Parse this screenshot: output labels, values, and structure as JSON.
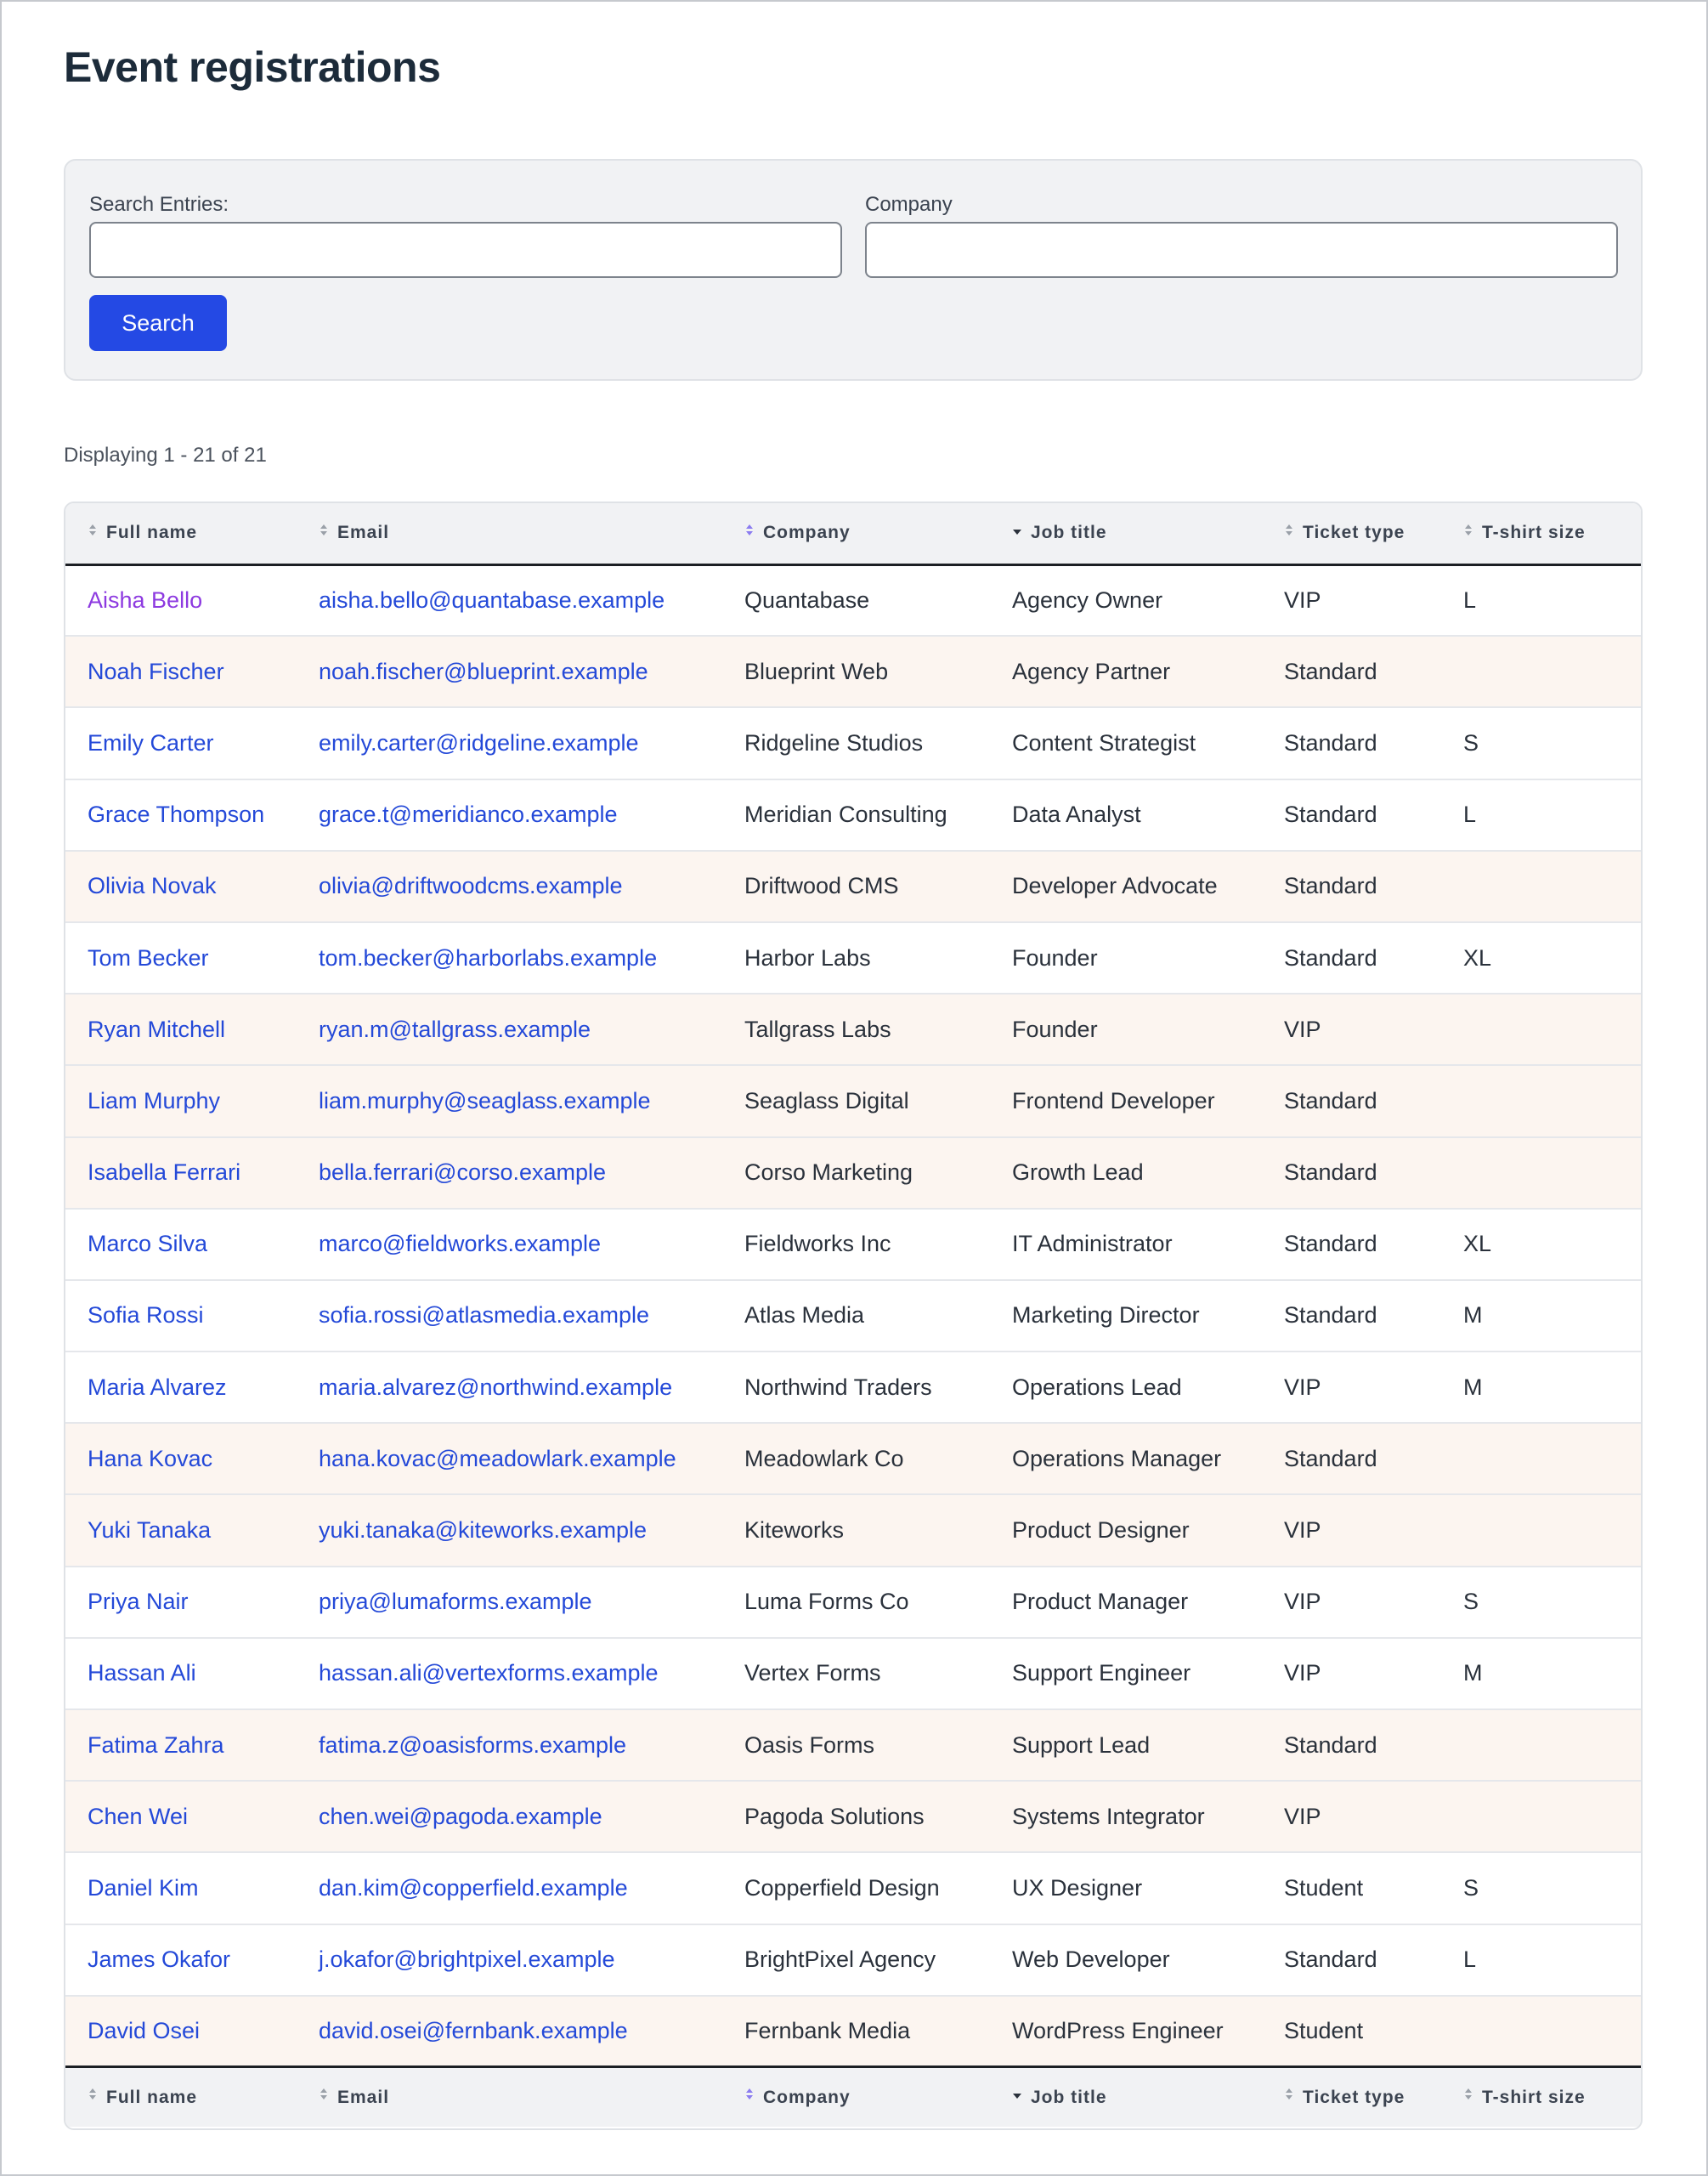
{
  "page": {
    "title": "Event registrations"
  },
  "search": {
    "entries_label": "Search Entries:",
    "entries_value": "",
    "company_label": "Company",
    "company_value": "",
    "button_label": "Search"
  },
  "result_count": "Displaying 1 - 21 of 21",
  "columns": [
    "Full name",
    "Email",
    "Company",
    "Job title",
    "Ticket type",
    "T-shirt size"
  ],
  "colors": {
    "link": "#2449d8",
    "visited_link": "#8d3ae0",
    "button": "#2449e4",
    "alt_row": "#fcf5f0",
    "header_bg": "#f1f2f4",
    "active_sort": "#8b7cf0"
  },
  "sort": {
    "active_column": "Job title",
    "direction": "descending"
  },
  "rows": [
    {
      "name": "Aisha Bello",
      "email": "aisha.bello@quantabase.example",
      "company": "Quantabase",
      "job": "Agency Owner",
      "ticket": "VIP",
      "size": "L",
      "highlight": false,
      "visited": true
    },
    {
      "name": "Noah Fischer",
      "email": "noah.fischer@blueprint.example",
      "company": "Blueprint Web",
      "job": "Agency Partner",
      "ticket": "Standard",
      "size": "",
      "highlight": true
    },
    {
      "name": "Emily Carter",
      "email": "emily.carter@ridgeline.example",
      "company": "Ridgeline Studios",
      "job": "Content Strategist",
      "ticket": "Standard",
      "size": "S",
      "highlight": false
    },
    {
      "name": "Grace Thompson",
      "email": "grace.t@meridianco.example",
      "company": "Meridian Consulting",
      "job": "Data Analyst",
      "ticket": "Standard",
      "size": "L",
      "highlight": false
    },
    {
      "name": "Olivia Novak",
      "email": "olivia@driftwoodcms.example",
      "company": "Driftwood CMS",
      "job": "Developer Advocate",
      "ticket": "Standard",
      "size": "",
      "highlight": true
    },
    {
      "name": "Tom Becker",
      "email": "tom.becker@harborlabs.example",
      "company": "Harbor Labs",
      "job": "Founder",
      "ticket": "Standard",
      "size": "XL",
      "highlight": false
    },
    {
      "name": "Ryan Mitchell",
      "email": "ryan.m@tallgrass.example",
      "company": "Tallgrass Labs",
      "job": "Founder",
      "ticket": "VIP",
      "size": "",
      "highlight": true
    },
    {
      "name": "Liam Murphy",
      "email": "liam.murphy@seaglass.example",
      "company": "Seaglass Digital",
      "job": "Frontend Developer",
      "ticket": "Standard",
      "size": "",
      "highlight": true
    },
    {
      "name": "Isabella Ferrari",
      "email": "bella.ferrari@corso.example",
      "company": "Corso Marketing",
      "job": "Growth Lead",
      "ticket": "Standard",
      "size": "",
      "highlight": true
    },
    {
      "name": "Marco Silva",
      "email": "marco@fieldworks.example",
      "company": "Fieldworks Inc",
      "job": "IT Administrator",
      "ticket": "Standard",
      "size": "XL",
      "highlight": false
    },
    {
      "name": "Sofia Rossi",
      "email": "sofia.rossi@atlasmedia.example",
      "company": "Atlas Media",
      "job": "Marketing Director",
      "ticket": "Standard",
      "size": "M",
      "highlight": false
    },
    {
      "name": "Maria Alvarez",
      "email": "maria.alvarez@northwind.example",
      "company": "Northwind Traders",
      "job": "Operations Lead",
      "ticket": "VIP",
      "size": "M",
      "highlight": false
    },
    {
      "name": "Hana Kovac",
      "email": "hana.kovac@meadowlark.example",
      "company": "Meadowlark Co",
      "job": "Operations Manager",
      "ticket": "Standard",
      "size": "",
      "highlight": true
    },
    {
      "name": "Yuki Tanaka",
      "email": "yuki.tanaka@kiteworks.example",
      "company": "Kiteworks",
      "job": "Product Designer",
      "ticket": "VIP",
      "size": "",
      "highlight": true
    },
    {
      "name": "Priya Nair",
      "email": "priya@lumaforms.example",
      "company": "Luma Forms Co",
      "job": "Product Manager",
      "ticket": "VIP",
      "size": "S",
      "highlight": false
    },
    {
      "name": "Hassan Ali",
      "email": "hassan.ali@vertexforms.example",
      "company": "Vertex Forms",
      "job": "Support Engineer",
      "ticket": "VIP",
      "size": "M",
      "highlight": false
    },
    {
      "name": "Fatima Zahra",
      "email": "fatima.z@oasisforms.example",
      "company": "Oasis Forms",
      "job": "Support Lead",
      "ticket": "Standard",
      "size": "",
      "highlight": true
    },
    {
      "name": "Chen Wei",
      "email": "chen.wei@pagoda.example",
      "company": "Pagoda Solutions",
      "job": "Systems Integrator",
      "ticket": "VIP",
      "size": "",
      "highlight": true
    },
    {
      "name": "Daniel Kim",
      "email": "dan.kim@copperfield.example",
      "company": "Copperfield Design",
      "job": "UX Designer",
      "ticket": "Student",
      "size": "S",
      "highlight": false
    },
    {
      "name": "James Okafor",
      "email": "j.okafor@brightpixel.example",
      "company": "BrightPixel Agency",
      "job": "Web Developer",
      "ticket": "Standard",
      "size": "L",
      "highlight": false
    },
    {
      "name": "David Osei",
      "email": "david.osei@fernbank.example",
      "company": "Fernbank Media",
      "job": "WordPress Engineer",
      "ticket": "Student",
      "size": "",
      "highlight": true
    }
  ]
}
